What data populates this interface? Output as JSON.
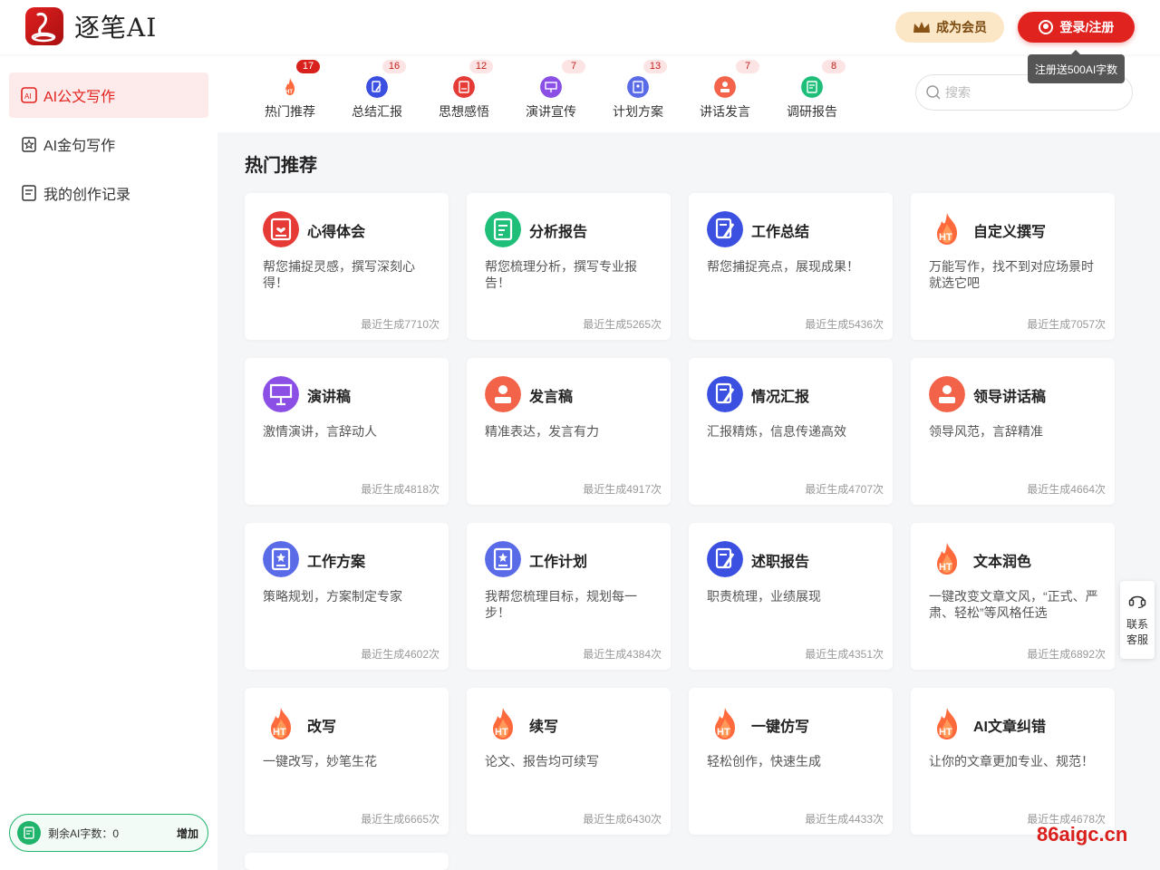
{
  "header": {
    "logo_text": "逐笔AI",
    "vip_label": "成为会员",
    "login_label": "登录/注册",
    "tooltip": "注册送500AI字数"
  },
  "sidebar": {
    "items": [
      {
        "label": "AI公文写作",
        "icon": "ai-doc-icon",
        "active": true
      },
      {
        "label": "AI金句写作",
        "icon": "star-card-icon",
        "active": false
      },
      {
        "label": "我的创作记录",
        "icon": "record-icon",
        "active": false
      }
    ],
    "quota_label": "剩余AI字数：0",
    "quota_add": "增加"
  },
  "categories": [
    {
      "label": "热门推荐",
      "count": "17",
      "color": "#ff6a3d",
      "icon": "flame-icon"
    },
    {
      "label": "总结汇报",
      "count": "16",
      "color": "#3b4fe0",
      "icon": "pen-doc-icon"
    },
    {
      "label": "思想感悟",
      "count": "12",
      "color": "#e63a36",
      "icon": "heart-doc-icon"
    },
    {
      "label": "演讲宣传",
      "count": "7",
      "color": "#8b4fe6",
      "icon": "presentation-icon"
    },
    {
      "label": "计划方案",
      "count": "13",
      "color": "#5a6be8",
      "icon": "plan-icon"
    },
    {
      "label": "讲话发言",
      "count": "7",
      "color": "#f2634a",
      "icon": "speaker-icon"
    },
    {
      "label": "调研报告",
      "count": "8",
      "color": "#1fbf7a",
      "icon": "report-icon"
    }
  ],
  "search": {
    "placeholder": "搜索"
  },
  "section_title": "热门推荐",
  "cards": [
    {
      "title": "心得体会",
      "desc": "帮您捕捉灵感，撰写深刻心得！",
      "stat": "最近生成7710次",
      "icon": "heart-doc-icon",
      "color": "#e63a36"
    },
    {
      "title": "分析报告",
      "desc": "帮您梳理分析，撰写专业报告！",
      "stat": "最近生成5265次",
      "icon": "report-icon",
      "color": "#1fbf7a"
    },
    {
      "title": "工作总结",
      "desc": "帮您捕捉亮点，展现成果！",
      "stat": "最近生成5436次",
      "icon": "pen-doc-icon",
      "color": "#3b4fe0"
    },
    {
      "title": "自定义撰写",
      "desc": "万能写作，找不到对应场景时就选它吧",
      "stat": "最近生成7057次",
      "icon": "flame-icon",
      "color": "#ff6a3d"
    },
    {
      "title": "演讲稿",
      "desc": "激情演讲，言辞动人",
      "stat": "最近生成4818次",
      "icon": "presentation-icon",
      "color": "#8b4fe6"
    },
    {
      "title": "发言稿",
      "desc": "精准表达，发言有力",
      "stat": "最近生成4917次",
      "icon": "speaker-icon",
      "color": "#f2634a"
    },
    {
      "title": "情况汇报",
      "desc": "汇报精炼，信息传递高效",
      "stat": "最近生成4707次",
      "icon": "pen-doc-icon",
      "color": "#3b4fe0"
    },
    {
      "title": "领导讲话稿",
      "desc": "领导风范，言辞精准",
      "stat": "最近生成4664次",
      "icon": "speaker-icon",
      "color": "#f2634a"
    },
    {
      "title": "工作方案",
      "desc": "策略规划，方案制定专家",
      "stat": "最近生成4602次",
      "icon": "plan-icon",
      "color": "#5a6be8"
    },
    {
      "title": "工作计划",
      "desc": "我帮您梳理目标，规划每一步！",
      "stat": "最近生成4384次",
      "icon": "plan-icon",
      "color": "#5a6be8"
    },
    {
      "title": "述职报告",
      "desc": "职责梳理，业绩展现",
      "stat": "最近生成4351次",
      "icon": "pen-doc-icon",
      "color": "#3b4fe0"
    },
    {
      "title": "文本润色",
      "desc": "一键改变文章文风，“正式、严肃、轻松”等风格任选",
      "stat": "最近生成6892次",
      "icon": "flame-icon",
      "color": "#ff6a3d"
    },
    {
      "title": "改写",
      "desc": "一键改写，妙笔生花",
      "stat": "最近生成6665次",
      "icon": "flame-icon",
      "color": "#ff6a3d"
    },
    {
      "title": "续写",
      "desc": "论文、报告均可续写",
      "stat": "最近生成6430次",
      "icon": "flame-icon",
      "color": "#ff6a3d"
    },
    {
      "title": "一键仿写",
      "desc": "轻松创作，快速生成",
      "stat": "最近生成4433次",
      "icon": "flame-icon",
      "color": "#ff6a3d"
    },
    {
      "title": "AI文章纠错",
      "desc": "让你的文章更加专业、规范！",
      "stat": "最近生成4678次",
      "icon": "flame-icon",
      "color": "#ff6a3d"
    }
  ],
  "service": {
    "line1": "联系",
    "line2": "客服"
  },
  "watermark": "86aigc.cn"
}
